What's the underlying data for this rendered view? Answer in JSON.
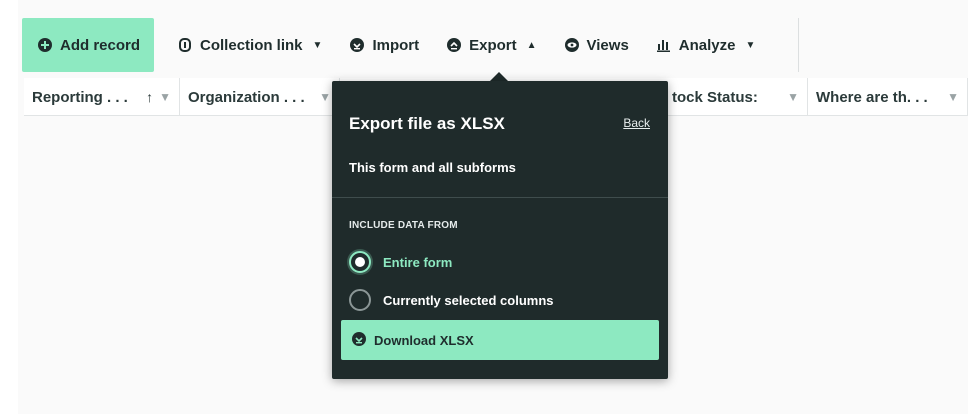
{
  "toolbar": {
    "add_record": "Add record",
    "collection_link": "Collection link",
    "import": "Import",
    "export": "Export",
    "views": "Views",
    "analyze": "Analyze"
  },
  "columns": [
    {
      "label": "Reporting . . ."
    },
    {
      "label": "Organization . . ."
    },
    {
      "label": "tock Status:"
    },
    {
      "label": "Where are th. . ."
    }
  ],
  "export_popover": {
    "title": "Export file as XLSX",
    "back": "Back",
    "subtitle": "This form and all subforms",
    "section_label": "INCLUDE DATA FROM",
    "options": [
      {
        "label": "Entire form",
        "selected": true
      },
      {
        "label": "Currently selected columns",
        "selected": false
      }
    ],
    "download_button": "Download XLSX"
  },
  "colors": {
    "accent": "#8de9c1",
    "popover_bg": "#1f2b2b",
    "text_dark": "#1f2d2d"
  },
  "icons": {
    "add_record": "plus-circle-icon",
    "collection_link": "link-icon",
    "import": "import-icon",
    "export": "export-icon",
    "views": "eye-icon",
    "analyze": "bar-chart-icon",
    "download": "download-icon"
  }
}
